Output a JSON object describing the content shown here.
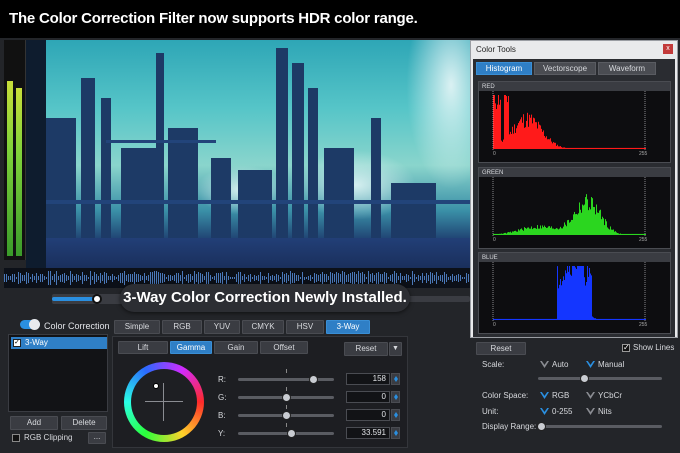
{
  "banner": {
    "text": "The Color Correction Filter now supports HDR color range."
  },
  "overlay": {
    "text": "3-Way Color Correction Newly Installed."
  },
  "color_correction": {
    "title": "Color Correction",
    "enabled": true,
    "filters": [
      "3-Way"
    ],
    "add_label": "Add",
    "delete_label": "Delete",
    "rgb_clipping_label": "RGB Clipping",
    "more_label": "...",
    "mode_tabs": [
      "Simple",
      "RGB",
      "YUV",
      "CMYK",
      "HSV",
      "3-Way"
    ],
    "active_mode": "3-Way",
    "range_tabs": [
      "Lift",
      "Gamma",
      "Gain",
      "Offset"
    ],
    "active_range": "Gamma",
    "reset_label": "Reset",
    "reset_dropdown_icon": "chevron-down-icon",
    "params": [
      {
        "label": "R:",
        "value": "158"
      },
      {
        "label": "G:",
        "value": "0"
      },
      {
        "label": "B:",
        "value": "0"
      },
      {
        "label": "Y:",
        "value": "33.591"
      }
    ]
  },
  "color_tools": {
    "title": "Color Tools",
    "close_label": "x",
    "tabs": [
      "Histogram",
      "Vectorscope",
      "Waveform"
    ],
    "active_tab": "Histogram",
    "histograms": [
      {
        "name": "RED",
        "color": "#ff1a1a",
        "axis_min": "0",
        "axis_max": "255"
      },
      {
        "name": "GREEN",
        "color": "#2bd61f",
        "axis_min": "0",
        "axis_max": "255"
      },
      {
        "name": "BLUE",
        "color": "#1436ff",
        "axis_min": "0",
        "axis_max": "255"
      }
    ],
    "reset_label": "Reset",
    "show_lines_label": "Show Lines",
    "show_lines_checked": true,
    "scale_label": "Scale:",
    "scale_options": [
      "Auto",
      "Manual"
    ],
    "scale_selected": "Manual",
    "color_space_label": "Color Space:",
    "color_space_options": [
      "RGB",
      "YCbCr"
    ],
    "color_space_selected": "RGB",
    "unit_label": "Unit:",
    "unit_options": [
      "0-255",
      "Nits"
    ],
    "unit_selected": "0-255",
    "display_range_label": "Display Range:"
  },
  "colors": {
    "accent": "#2f7fc6",
    "panel": "#232529",
    "banner": "#000000"
  }
}
